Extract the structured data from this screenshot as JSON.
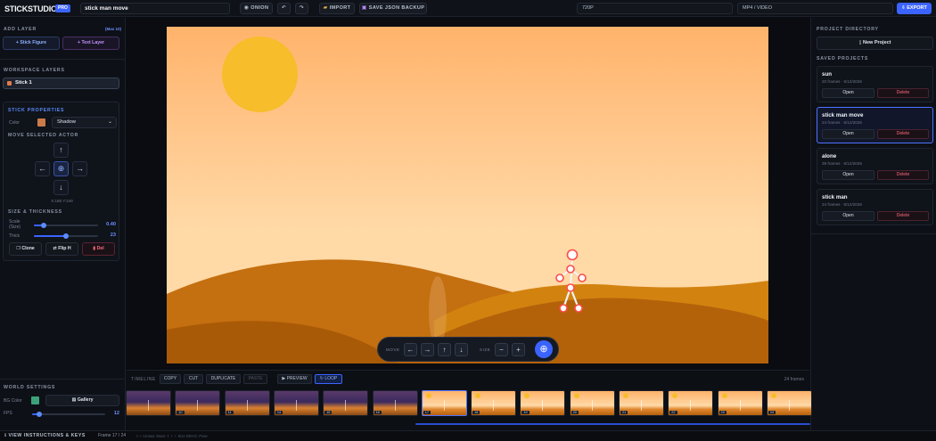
{
  "header": {
    "logo": "STICKSTUDIO",
    "badge": "PRO",
    "project_name": "stick man move",
    "onion_label": "ONION",
    "undo_icon": "undo-icon",
    "redo_icon": "redo-icon",
    "import_label": "IMPORT",
    "save_label": "SAVE JSON BACKUP",
    "resolution": "720P",
    "format": "MP4 / VIDEO",
    "export_label": "EXPORT"
  },
  "left": {
    "add_layer_title": "ADD LAYER",
    "max_note": "(Max 10)",
    "stick_figure_btn": "+ Stick Figure",
    "text_layer_btn": "+ Text Layer",
    "workspace_title": "WORKSPACE LAYERS",
    "layers": [
      {
        "name": "Stick 1",
        "color": "#e07a4a"
      }
    ],
    "props_title": "STICK PROPERTIES",
    "color_label": "Color",
    "color_value": "#cc7a4a",
    "shadow_option": "Shadow",
    "move_title": "MOVE SELECTED ACTOR",
    "coords": "X:188 Y:249",
    "size_title": "SIZE & THICKNESS",
    "scale_label": "Scale (Size)",
    "scale_value": "0.40",
    "scale_level": 0.15,
    "thick_label": "Thick",
    "thick_value": "23",
    "thick_level": 0.5,
    "clone_btn": "Clone",
    "flip_btn": "Flip H",
    "del_btn": "Del"
  },
  "world": {
    "title": "WORLD SETTINGS",
    "bg_label": "BG Color",
    "bg_color": "#3aa37a",
    "gallery_btn": "Gallery",
    "fps_label": "FPS",
    "fps_value": "12",
    "fps_level": 0.1
  },
  "canvas_bar": {
    "move_label": "MOVE",
    "size_label": "SIZE",
    "minus": "−",
    "plus": "+"
  },
  "timeline": {
    "label": "TIMELINE",
    "copy": "COPY",
    "cut": "CUT",
    "duplicate": "DUPLICATE",
    "paste": "PASTE",
    "preview": "▶ PREVIEW",
    "loop": "↻ LOOP",
    "frame_count": "24 frames",
    "frames": [
      "",
      "10",
      "11",
      "14",
      "15",
      "16",
      "17",
      "18",
      "19",
      "20",
      "21",
      "22",
      "23",
      "24"
    ]
  },
  "right": {
    "dir_title": "PROJECT DIRECTORY",
    "new_project": "New Project",
    "saved_title": "SAVED PROJECTS",
    "projects": [
      {
        "name": "sun",
        "meta": "20 frames · 6/12/2026",
        "open": "Open",
        "delete": "Delete"
      },
      {
        "name": "stick man move",
        "meta": "24 frames · 6/12/2026",
        "open": "Open",
        "delete": "Delete"
      },
      {
        "name": "alone",
        "meta": "39 frames · 6/12/2026",
        "open": "Open",
        "delete": "Delete"
      },
      {
        "name": "stick man",
        "meta": "24 frames · 6/12/2026",
        "open": "Open",
        "delete": "Delete"
      }
    ]
  },
  "status": {
    "instructions": "VIEW INSTRUCTIONS & KEYS",
    "frame": "Frame 17 / 24",
    "hint": "⇧ + Arrows: Move   ⇧ + ↑: Size   DRAG: Pose"
  }
}
